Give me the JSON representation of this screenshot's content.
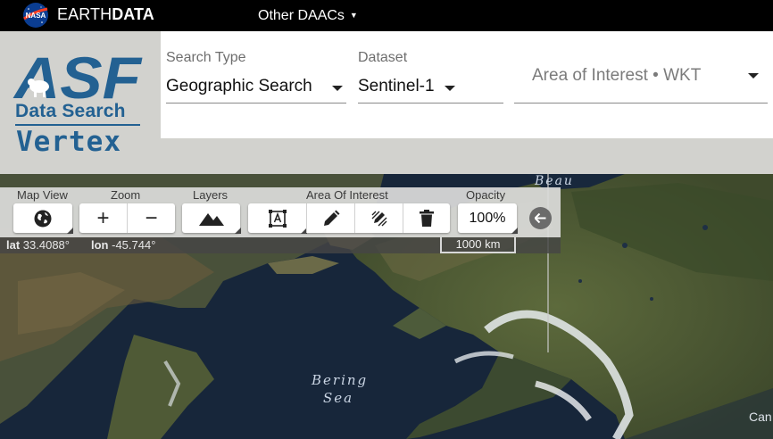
{
  "topbar": {
    "brand_light": "EARTH",
    "brand_bold": "DATA",
    "daacs_label": "Other DAACs"
  },
  "logo": {
    "asf": "ASF",
    "line1": "Data Search",
    "line2": "Vertex"
  },
  "search": {
    "type_label": "Search Type",
    "type_value": "Geographic Search",
    "dataset_label": "Dataset",
    "dataset_value": "Sentinel-1",
    "aoi_placeholder": "Area of Interest • WKT"
  },
  "toolbar": {
    "map_view_label": "Map View",
    "zoom_label": "Zoom",
    "layers_label": "Layers",
    "aoi_label": "Area Of Interest",
    "opacity_label": "Opacity",
    "zoom_in": "+",
    "zoom_out": "−",
    "opacity_value": "100%"
  },
  "coords": {
    "lat_label": "lat",
    "lat_value": "33.4088°",
    "lon_label": "lon",
    "lon_value": "-45.744°",
    "scale": "1000 km"
  },
  "map": {
    "labels": {
      "bering_1": "Bering",
      "bering_2": "Sea",
      "beaufort": "Beau",
      "canada": "Can"
    }
  },
  "icons": {
    "nasa": "nasa-meatball-icon",
    "globe": "globe-icon",
    "layers": "mountains-icon",
    "aoi_box": "draw-box-icon",
    "pencil": "pencil-icon",
    "edit": "edit-shape-icon",
    "trash": "trash-icon",
    "collapse": "arrow-left-icon"
  },
  "colors": {
    "accent": "#236192",
    "topbar_bg": "#000000",
    "header_gray": "#d2d2ce"
  }
}
